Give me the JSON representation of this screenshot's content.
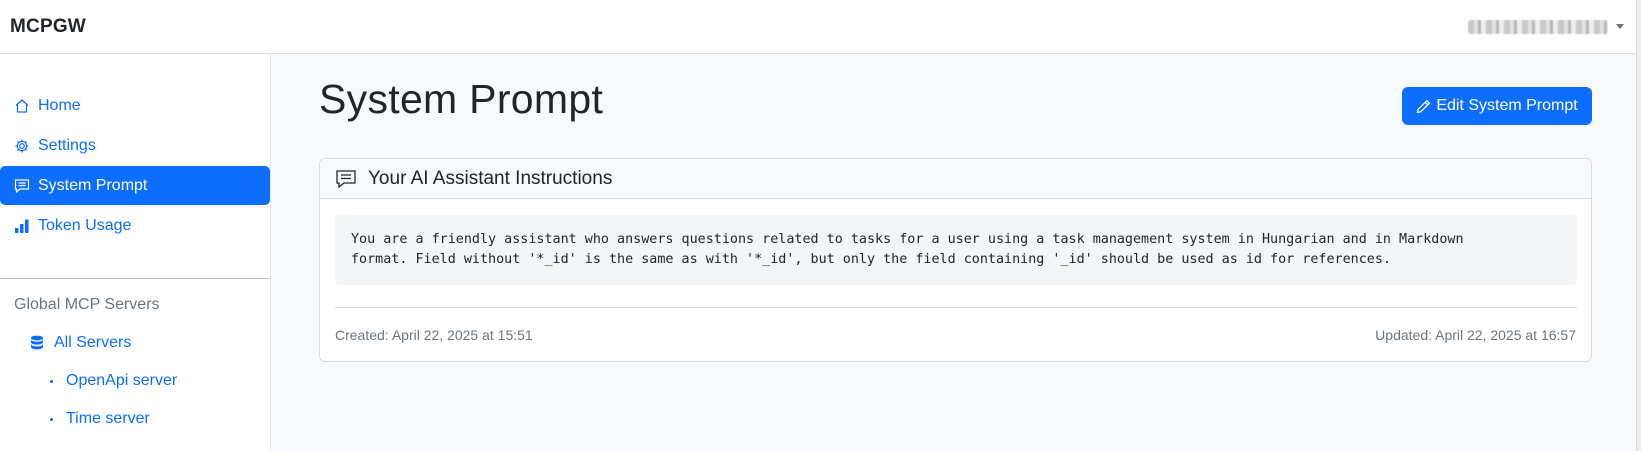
{
  "app": {
    "brand": "MCPGW"
  },
  "user": {
    "name_redacted": true
  },
  "sidebar": {
    "items": [
      {
        "label": "Home",
        "icon": "house-icon",
        "active": false
      },
      {
        "label": "Settings",
        "icon": "gear-icon",
        "active": false
      },
      {
        "label": "System Prompt",
        "icon": "chat-text-icon",
        "active": true
      },
      {
        "label": "Token Usage",
        "icon": "bar-chart-icon",
        "active": false
      }
    ],
    "section_title": "Global MCP Servers",
    "all_servers": {
      "label": "All Servers",
      "icon": "database-icon"
    },
    "servers": [
      {
        "label": "OpenApi server"
      },
      {
        "label": "Time server"
      }
    ]
  },
  "main": {
    "title": "System Prompt",
    "edit_button_label": "Edit System Prompt",
    "card": {
      "header": "Your AI Assistant Instructions",
      "prompt_text": "You are a friendly assistant who answers questions related to tasks for a user using a task management system in Hungarian and in Markdown\nformat. Field without '*_id' is the same as with '*_id', but only the field containing '_id' should be used as id for references.",
      "created": "Created: April 22, 2025 at 15:51",
      "updated": "Updated: April 22, 2025 at 16:57"
    }
  },
  "colors": {
    "primary": "#0d6efd",
    "muted": "#6c757d",
    "main_bg": "#f8f9fa"
  }
}
